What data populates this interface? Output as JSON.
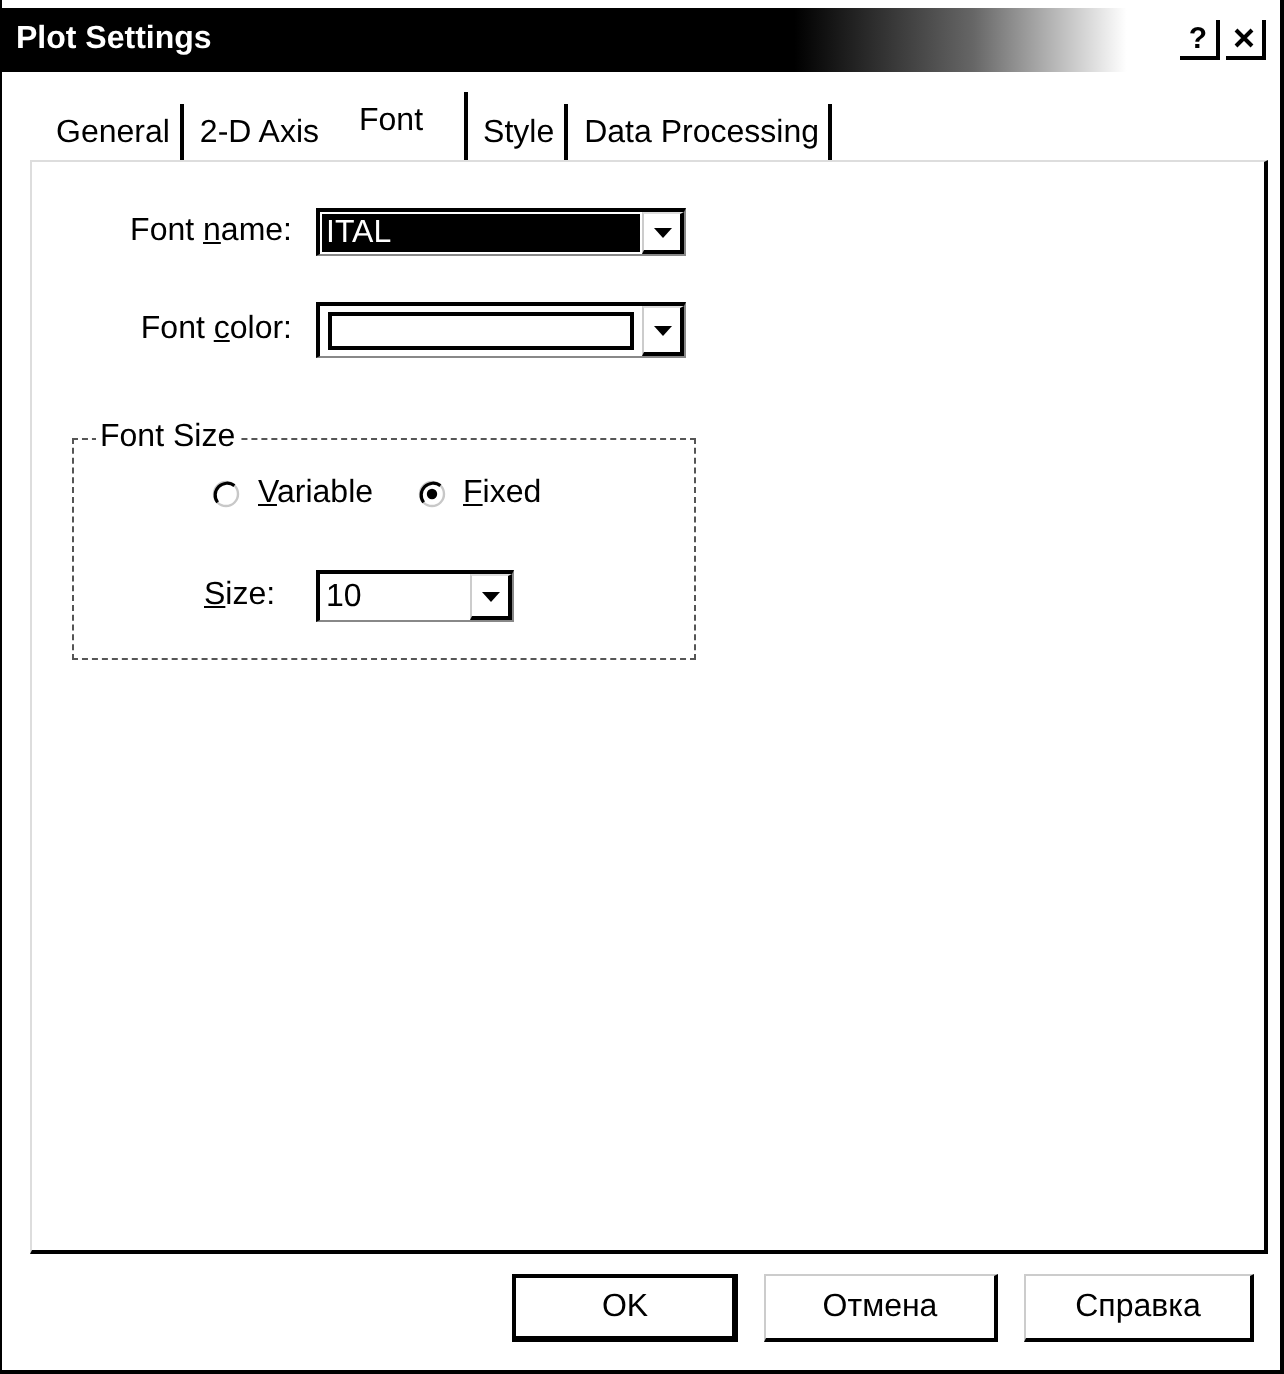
{
  "window": {
    "title": "Plot Settings",
    "help_label": "?"
  },
  "tabs": [
    {
      "label": "General",
      "selected": false
    },
    {
      "label": "2-D Axis",
      "selected": false
    },
    {
      "label": "Font",
      "selected": true
    },
    {
      "label": "Style",
      "selected": false
    },
    {
      "label": "Data Processing",
      "selected": false
    }
  ],
  "fields": [
    {
      "kind": "text",
      "label": {
        "before": "Font ",
        "key": "n",
        "after": "ame:"
      },
      "value": "ITAL",
      "highlighted": true
    },
    {
      "kind": "color",
      "label": {
        "before": "Font ",
        "key": "c",
        "after": "olor:"
      },
      "color": "#ffffff"
    }
  ],
  "font_size": {
    "title": "Font Size",
    "options": [
      {
        "label": {
          "key": "V",
          "after": "ariable"
        },
        "selected": false
      },
      {
        "label": {
          "key": "F",
          "after": "ixed"
        },
        "selected": true
      }
    ],
    "size": {
      "label": {
        "key": "S",
        "after": "ize:"
      },
      "value": "10"
    }
  },
  "buttons": [
    {
      "label": "OK",
      "default": true
    },
    {
      "label": "Отмена",
      "default": false
    },
    {
      "label": "Справка",
      "default": false
    }
  ]
}
